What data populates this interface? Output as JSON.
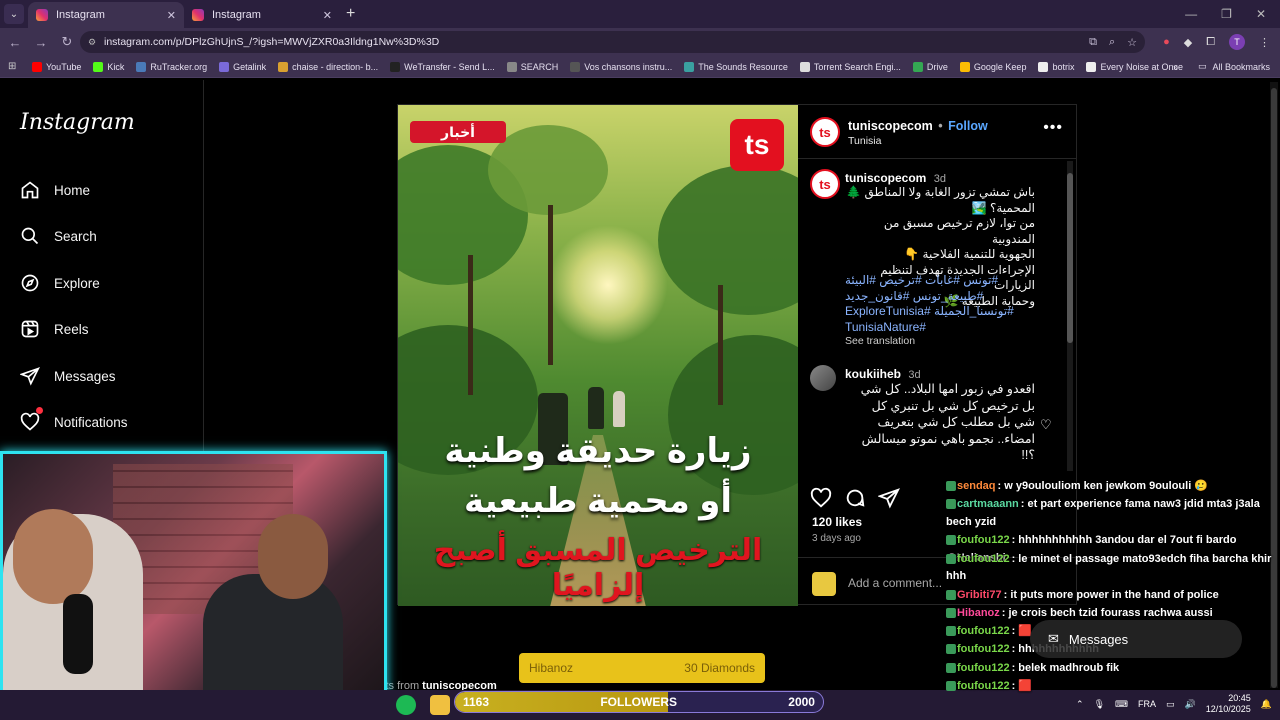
{
  "browser": {
    "tabs": [
      {
        "label": "Instagram",
        "active": true
      },
      {
        "label": "Instagram",
        "active": false
      }
    ],
    "new_tab": "+",
    "url": "instagram.com/p/DPlzGhUjnS_/?igsh=MWVjZXR0a3Ildng1Nw%3D%3D",
    "profile_initial": "T",
    "bookmarks": [
      {
        "label": "YouTube",
        "color": "#ff0000"
      },
      {
        "label": "Kick",
        "color": "#53fc18"
      },
      {
        "label": "RuTracker.org",
        "color": "#4a7ab8"
      },
      {
        "label": "Getalink",
        "color": "#7a6ad8"
      },
      {
        "label": "chaise - direction- b...",
        "color": "#d8a030"
      },
      {
        "label": "WeTransfer - Send L...",
        "color": "#222222"
      },
      {
        "label": "SEARCH",
        "color": "#888888"
      },
      {
        "label": "Vos chansons instru...",
        "color": "#555555"
      },
      {
        "label": "The Sounds Resource",
        "color": "#3aa0a0"
      },
      {
        "label": "Torrent Search Engi...",
        "color": "#dddddd"
      },
      {
        "label": "Drive",
        "color": "#34a853"
      },
      {
        "label": "Google Keep",
        "color": "#fbbc04"
      },
      {
        "label": "botrix",
        "color": "#eeeeee"
      },
      {
        "label": "Every Noise at Once",
        "color": "#eeeeee"
      }
    ],
    "all_bookmarks": "All Bookmarks"
  },
  "instagram": {
    "logo": "Instagram",
    "nav": [
      {
        "label": "Home",
        "icon": "home-icon"
      },
      {
        "label": "Search",
        "icon": "search-icon"
      },
      {
        "label": "Explore",
        "icon": "explore-icon"
      },
      {
        "label": "Reels",
        "icon": "reels-icon"
      },
      {
        "label": "Messages",
        "icon": "messages-icon"
      },
      {
        "label": "Notifications",
        "icon": "heart-icon"
      }
    ],
    "post": {
      "image": {
        "badge": "أخبار",
        "logo": "ts",
        "headline1": "زيارة حديقة وطنية",
        "headline2": "أو محمية طبيعية",
        "headline3": "الترخيص المسبق أصبح إلزاميًا"
      },
      "author": "tuniscopecom",
      "follow": "Follow",
      "dot": "•",
      "location": "Tunisia",
      "caption": {
        "user": "tuniscopecom",
        "time": "3d",
        "lines": [
          "باش تمشي تزور الغابة ولا المناطق 🌲",
          "المحمية؟ 🏞️",
          "من توا، لازم ترخيص مسبق من المندوبية",
          "الجهوية للتنمية الفلاحية 👇",
          "الإجراءات الجديدة تهدف لتنظيم الزيارات",
          "وحماية الطبيعة 🌿"
        ],
        "tags": [
          "#تونس #غابات #ترخيص #البيئة",
          "#طبيعة_تونس #قانون_جديد",
          "#تونسنا_الجميلة #ExploreTunisia",
          "#TunisiaNature"
        ],
        "see_translation": "See translation"
      },
      "comment": {
        "user": "koukiiheb",
        "time": "3d",
        "lines": [
          "اقعدو في زبور امها البلاد.. كل شي",
          "بل ترخيص كل شي بل تنبري كل",
          "شي بل مطلب كل شي بتعريف",
          "امضاء.. نجمو باهي نموتو ميسالش",
          "؟!!"
        ]
      },
      "likes": "120 likes",
      "ago": "3 days ago",
      "add_comment": "Add a comment...",
      "more_from_prefix": "sts from ",
      "more_from_user": "tuniscopecom"
    }
  },
  "chat": [
    {
      "user": "sendaq",
      "color": "#ff8a3a",
      "text": ": w y9oulouliom ken jewkom 9oulouli 🥲"
    },
    {
      "user": "cartmaaann",
      "color": "#5ad8a0",
      "text": ": et part experience fama naw3 jdid mta3 j3ala bech yzid"
    },
    {
      "user": "foufou122",
      "color": "#7ad84a",
      "text": ": hhhhhhhhhhh 3andou dar el 7out fi bardo @Helianshi"
    },
    {
      "user": "foufou122",
      "color": "#7ad84a",
      "text": ": le minet el passage mato93edch fiha barcha khir hhh"
    },
    {
      "user": "Gribiti77",
      "color": "#ff4a6a",
      "text": ": it puts more power in the hand of police"
    },
    {
      "user": "Hibanoz",
      "color": "#ff4a9a",
      "text": ": je crois bech tzid fourass rachwa aussi"
    },
    {
      "user": "foufou122",
      "color": "#7ad84a",
      "text": ": 🟥"
    },
    {
      "user": "foufou122",
      "color": "#7ad84a",
      "text": ": hhhhhhhhhhhh"
    },
    {
      "user": "foufou122",
      "color": "#7ad84a",
      "text": ": belek madhroub fik"
    },
    {
      "user": "foufou122",
      "color": "#7ad84a",
      "text": ": 🟥"
    }
  ],
  "messages_pill": "Messages",
  "alert": {
    "user": "Hibanoz",
    "amount": "30 Diamonds"
  },
  "followers_bar": {
    "current": "1163",
    "label": "FOLLOWERS",
    "goal": "2000",
    "progress": 0.58
  },
  "taskbar": {
    "lang": "FRA",
    "time": "20:45",
    "date": "12/10/2025"
  }
}
